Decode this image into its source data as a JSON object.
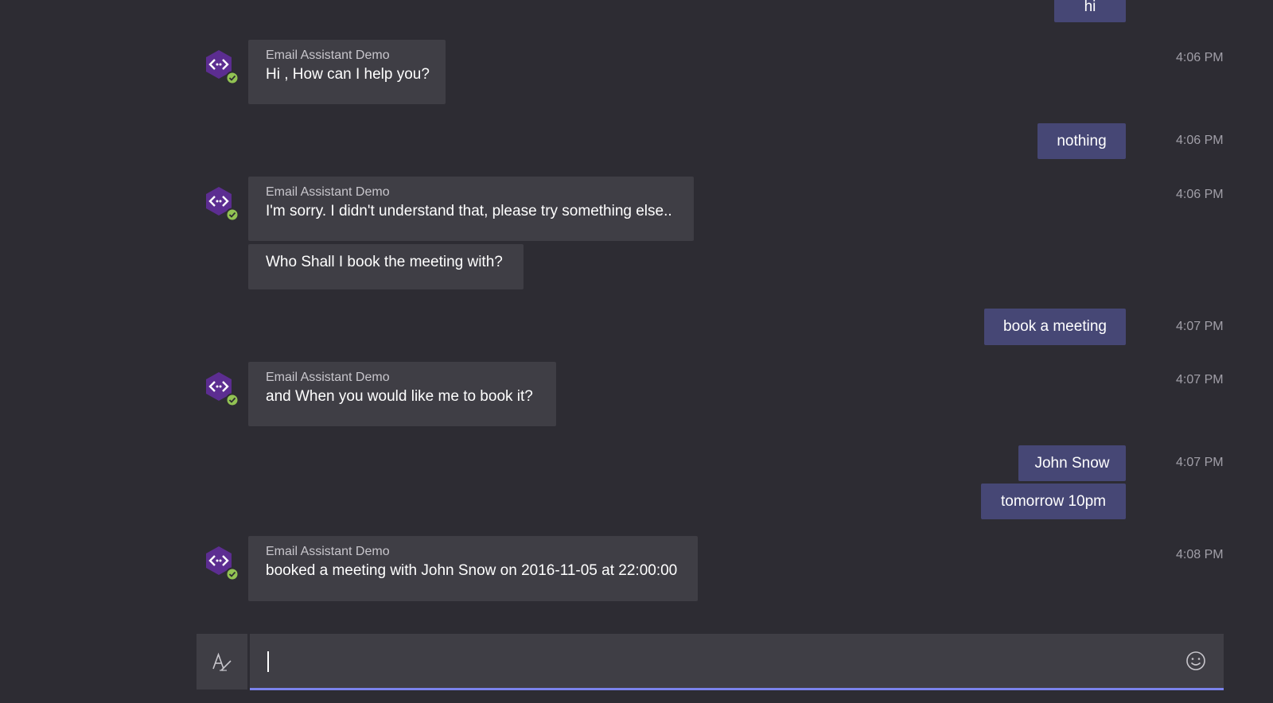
{
  "colors": {
    "background": "#2d2c33",
    "incoming_bubble": "#3f3e45",
    "outgoing_bubble": "#464775",
    "bot_avatar": "#5c2d91",
    "status_badge": "#92c353",
    "input_underline": "#7b83eb"
  },
  "messages": [
    {
      "direction": "out",
      "text": "hi"
    },
    {
      "direction": "in",
      "sender": "Email Assistant Demo",
      "text": "Hi , How can I help you?",
      "time": "4:06 PM"
    },
    {
      "direction": "out",
      "text": "nothing",
      "time": "4:06 PM"
    },
    {
      "direction": "in",
      "sender": "Email Assistant Demo",
      "text": "I'm sorry. I didn't understand that, please try something else..",
      "time": "4:06 PM"
    },
    {
      "direction": "in",
      "text": "Who Shall I book the meeting with?"
    },
    {
      "direction": "out",
      "text": "book a meeting",
      "time": "4:07 PM"
    },
    {
      "direction": "in",
      "sender": "Email Assistant Demo",
      "text": "and When you would like me to book it?",
      "time": "4:07 PM"
    },
    {
      "direction": "out",
      "text": "John Snow",
      "time": "4:07 PM"
    },
    {
      "direction": "out",
      "text": "tomorrow 10pm"
    },
    {
      "direction": "in",
      "sender": "Email Assistant Demo",
      "text": "booked a meeting with John Snow on 2016-11-05 at 22:00:00",
      "time": "4:08 PM"
    }
  ],
  "composer": {
    "value": "",
    "format_icon": "format-text-icon",
    "emoji_icon": "emoji-icon"
  },
  "icons": {
    "bot_avatar": "bot-code-hexagon-icon",
    "status": "available-check-icon"
  }
}
